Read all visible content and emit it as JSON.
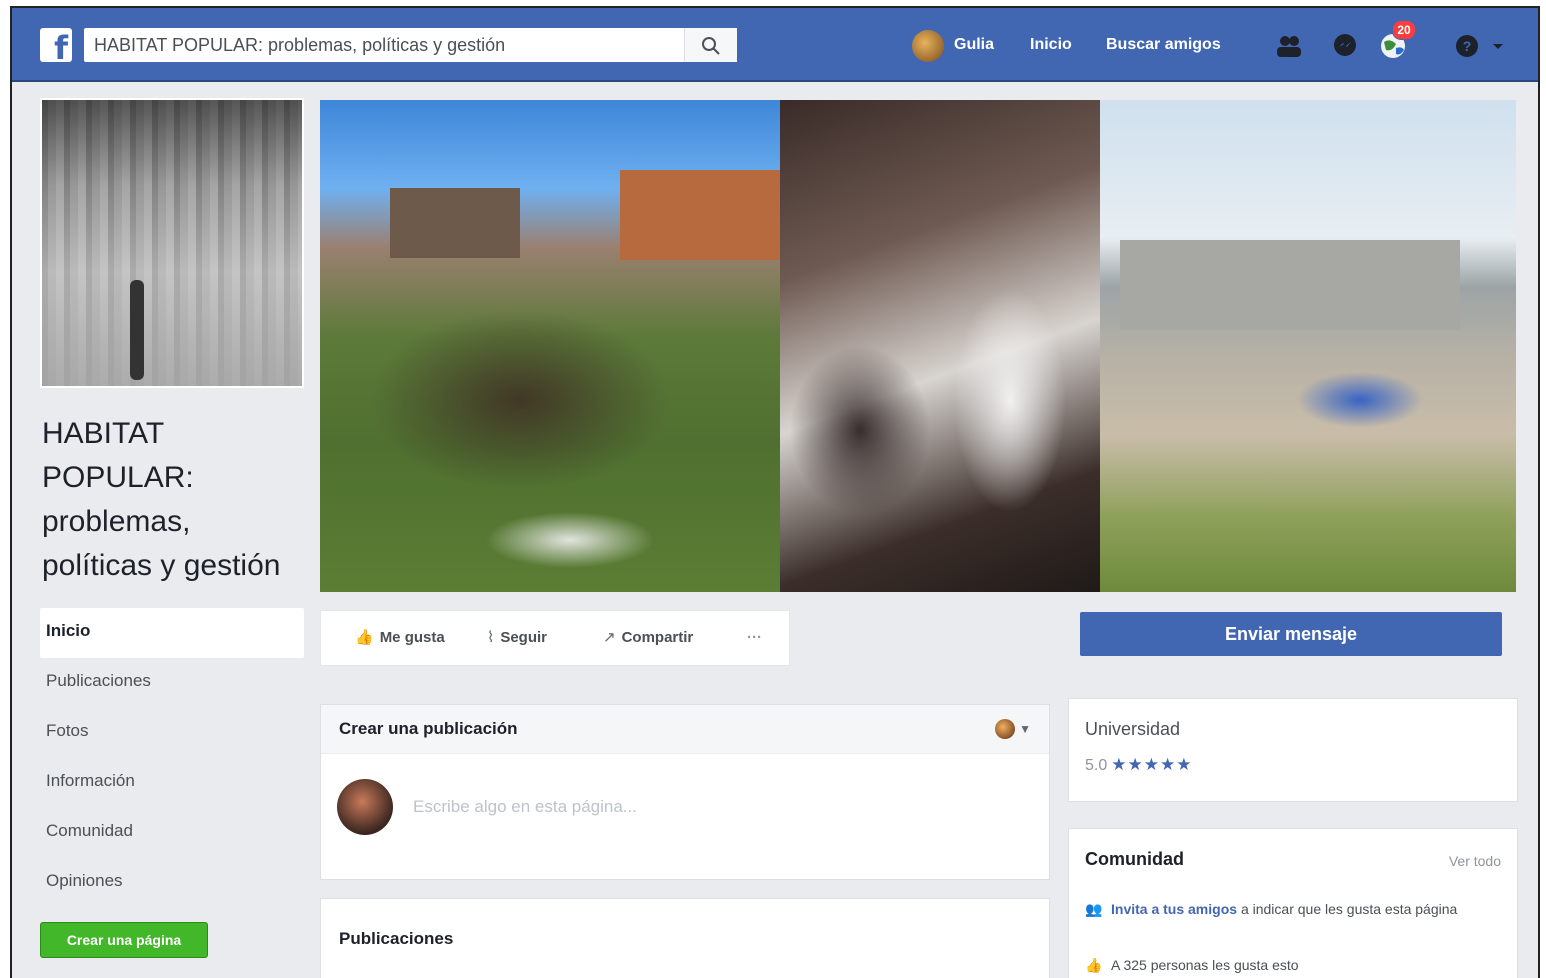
{
  "topbar": {
    "logo": "f",
    "search_value": "HABITAT POPULAR: problemas, políticas y gestión",
    "user_name": "Gulia",
    "home_label": "Inicio",
    "find_friends_label": "Buscar amigos",
    "notifications_count": "20",
    "brand_color": "#4267b2"
  },
  "page": {
    "name": "HABITAT POPULAR: problemas, políticas y gestión"
  },
  "left_nav": {
    "items": [
      {
        "label": "Inicio",
        "active": true
      },
      {
        "label": "Publicaciones"
      },
      {
        "label": "Fotos"
      },
      {
        "label": "Información"
      },
      {
        "label": "Comunidad"
      },
      {
        "label": "Opiniones"
      }
    ],
    "create_page_label": "Crear una página",
    "create_page_color": "#42b72a"
  },
  "actions": {
    "like_label": "Me gusta",
    "follow_label": "Seguir",
    "share_label": "Compartir",
    "more_label": "···",
    "send_message_label": "Enviar mensaje"
  },
  "create_post": {
    "title": "Crear una publicación",
    "placeholder": "Escribe algo en esta página..."
  },
  "posts": {
    "title": "Publicaciones"
  },
  "about": {
    "category": "Universidad",
    "rating": "5.0",
    "stars": "★★★★★"
  },
  "community": {
    "title": "Comunidad",
    "see_all": "Ver todo",
    "invite_link": "Invita a tus amigos",
    "invite_rest": "a indicar que les gusta esta página",
    "likes_text": "A 325 personas les gusta esto"
  }
}
